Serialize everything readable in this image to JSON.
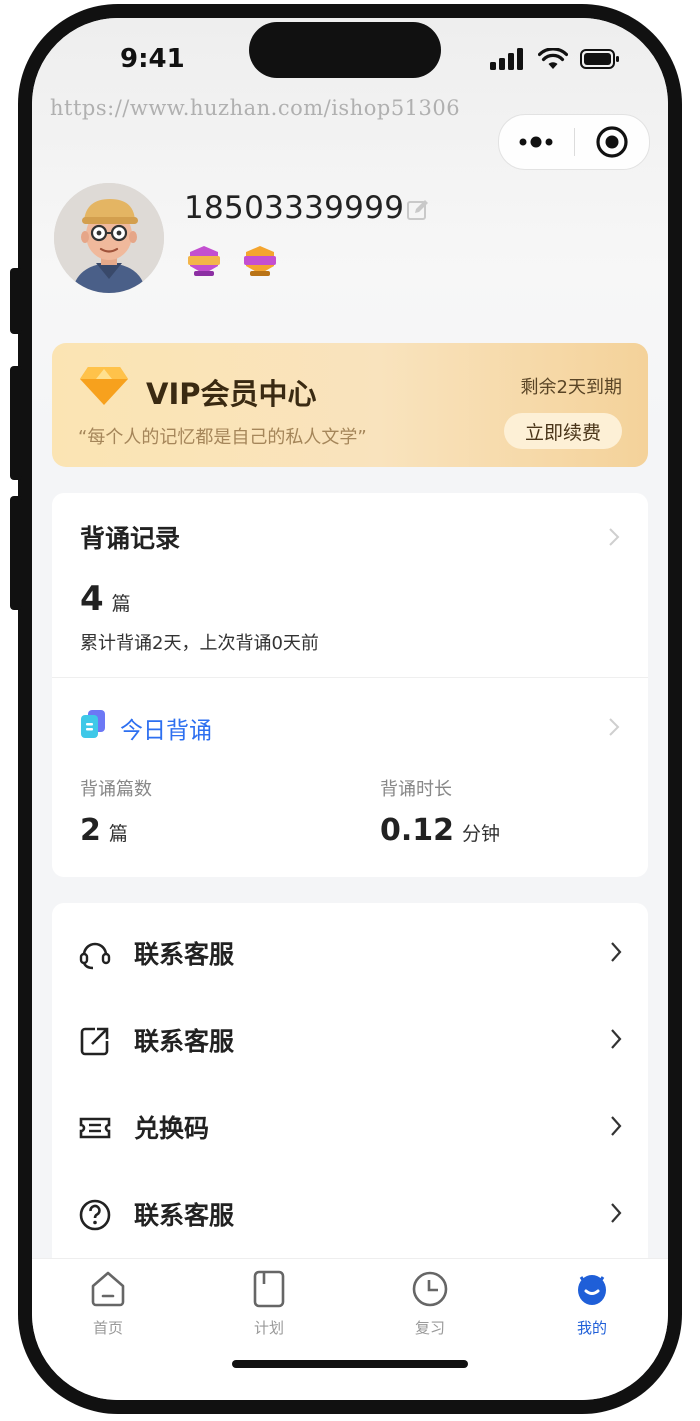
{
  "status_bar": {
    "time": "9:41"
  },
  "watermark": "https://www.huzhan.com/ishop51306",
  "capsule": {
    "more_icon": "more-dots-icon",
    "close_icon": "target-circle-icon"
  },
  "profile": {
    "phone": "18503339999",
    "edit_icon": "edit-icon",
    "badges": [
      {
        "name": "badge-purple",
        "color": "#c34fd0"
      },
      {
        "name": "badge-orange",
        "color": "#f4a52f"
      }
    ]
  },
  "vip": {
    "title": "VIP会员中心",
    "subtitle": "“每个人的记忆都是自己的私人文学”",
    "expire": "剩余2天到期",
    "renew": "立即续费",
    "icon": "diamond-icon"
  },
  "records": {
    "title": "背诵记录",
    "count": "4",
    "count_unit": "篇",
    "desc": "累计背诵2天，上次背诵0天前",
    "today": {
      "title": "今日背诵",
      "articles_label": "背诵篇数",
      "articles_value": "2",
      "articles_unit": "篇",
      "duration_label": "背诵时长",
      "duration_value": "0.12",
      "duration_unit": "分钟"
    }
  },
  "menu": [
    {
      "label": "联系客服",
      "icon": "headset-icon"
    },
    {
      "label": "联系客服",
      "icon": "external-link-icon"
    },
    {
      "label": "兑换码",
      "icon": "ticket-icon"
    },
    {
      "label": "联系客服",
      "icon": "question-circle-icon"
    }
  ],
  "tabbar": [
    {
      "label": "首页",
      "icon": "home-icon",
      "active": false
    },
    {
      "label": "计划",
      "icon": "bookmark-icon",
      "active": false
    },
    {
      "label": "复习",
      "icon": "clock-icon",
      "active": false
    },
    {
      "label": "我的",
      "icon": "user-icon",
      "active": true
    }
  ],
  "colors": {
    "accent": "#2d6ff0",
    "tab_active": "#1f5fd8",
    "vip_gold": "#f9e3bd"
  }
}
